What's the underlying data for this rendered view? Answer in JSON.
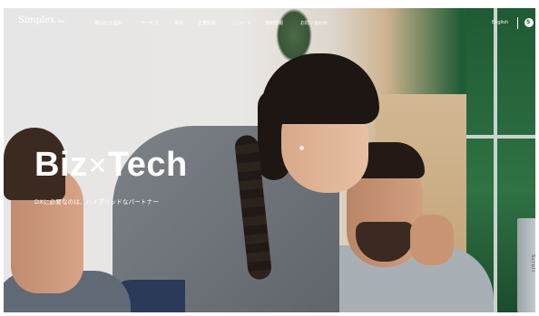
{
  "brand": {
    "logo": "Simplex",
    "logo_suffix": "Inc."
  },
  "nav": {
    "items": [
      "選ばれる理由",
      "サービス",
      "事例",
      "企業情報",
      "ニュース",
      "採用情報",
      "お問い合わせ"
    ],
    "language": "English",
    "menu_icon": "S"
  },
  "hero": {
    "title_left": "Biz",
    "title_sep": "×",
    "title_right": "Tech",
    "subtitle": "DXに必要なのは、ハイブリッドなパートナー"
  },
  "side_label": "Scroll",
  "colors": {
    "accent": "#1f5c35",
    "text_on_image": "#ffffff"
  }
}
